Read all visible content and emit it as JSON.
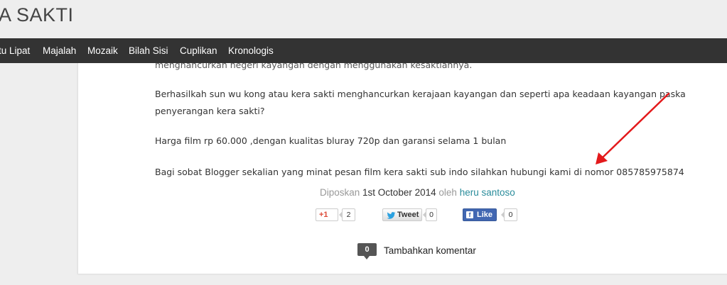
{
  "header": {
    "title": "A SAKTI"
  },
  "nav": {
    "items": [
      {
        "label": "tu Lipat"
      },
      {
        "label": "Majalah"
      },
      {
        "label": "Mozaik"
      },
      {
        "label": "Bilah Sisi"
      },
      {
        "label": "Cuplikan"
      },
      {
        "label": "Kronologis"
      }
    ]
  },
  "post": {
    "cut_text": "menghancurkan negeri kayangan dengan menggunakan kesaktiannya.",
    "p1_line1": "Berhasilkah sun wu kong atau kera sakti menghancurkan kerajaan kayangan dan seperti apa keadaan kayangan paska",
    "p1_line2": "penyerangan kera sakti?",
    "p2": "Harga film rp 60.000 ,dengan kualitas bluray 720p dan garansi selama 1 bulan",
    "p3": "Bagi sobat Blogger sekalian yang minat pesan film kera sakti sub indo silahkan hubungi kami di nomor 085785975874",
    "meta": {
      "posted_label": "Diposkan",
      "date": "1st October 2014",
      "by_label": "oleh",
      "author": "heru santoso"
    }
  },
  "share": {
    "gplus_label": "+1",
    "gplus_count": "2",
    "tweet_label": "Tweet",
    "tweet_count": "0",
    "like_label": "Like",
    "like_count": "0"
  },
  "comments": {
    "count": "0",
    "label": "Tambahkan komentar"
  },
  "annotation": {
    "color": "#e3191b"
  }
}
